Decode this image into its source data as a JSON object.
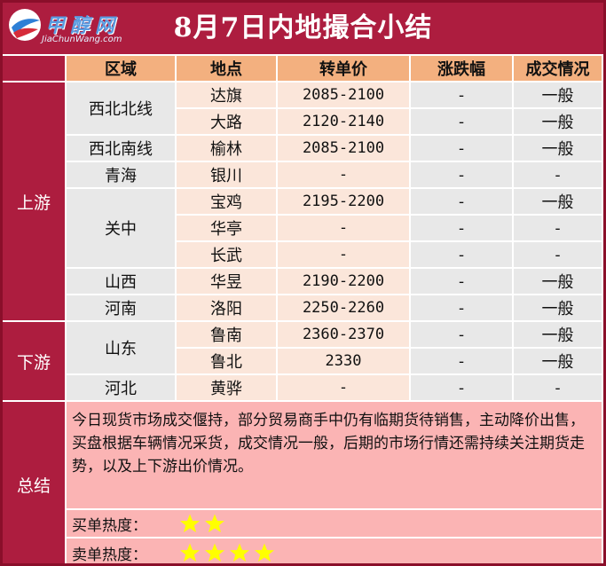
{
  "logo": {
    "cn": "甲醇网",
    "en": "JiaChunWang.com"
  },
  "title": "8月7日内地撮合小结",
  "headers": [
    "区域",
    "地点",
    "转单价",
    "涨跌幅",
    "成交情况"
  ],
  "zones": {
    "upstream": "上游",
    "downstream": "下游",
    "summary": "总结"
  },
  "regions": [
    "西北北线",
    "西北南线",
    "青海",
    "关中",
    "山西",
    "河南",
    "山东",
    "河北"
  ],
  "rows": [
    {
      "place": "达旗",
      "price": "2085-2100",
      "change": "-",
      "volume": "一般"
    },
    {
      "place": "大路",
      "price": "2120-2140",
      "change": "-",
      "volume": "一般"
    },
    {
      "place": "榆林",
      "price": "2085-2100",
      "change": "-",
      "volume": "一般"
    },
    {
      "place": "银川",
      "price": "-",
      "change": "-",
      "volume": "-"
    },
    {
      "place": "宝鸡",
      "price": "2195-2200",
      "change": "-",
      "volume": "一般"
    },
    {
      "place": "华亭",
      "price": "-",
      "change": "-",
      "volume": "-"
    },
    {
      "place": "长武",
      "price": "-",
      "change": "-",
      "volume": "-"
    },
    {
      "place": "华昱",
      "price": "2190-2200",
      "change": "-",
      "volume": "一般"
    },
    {
      "place": "洛阳",
      "price": "2250-2260",
      "change": "-",
      "volume": "一般"
    },
    {
      "place": "鲁南",
      "price": "2360-2370",
      "change": "-",
      "volume": "一般"
    },
    {
      "place": "鲁北",
      "price": "2330",
      "change": "-",
      "volume": "一般"
    },
    {
      "place": "黄骅",
      "price": "-",
      "change": "-",
      "volume": "-"
    }
  ],
  "summary": {
    "text": "今日现货市场成交偃持，部分贸易商手中仍有临期货待销售，主动降价出售，买盘根据车辆情况采货，成交情况一般，后期的市场行情还需持续关注期货走势，以及上下游出价情况。",
    "buy_heat_label": "买单热度：",
    "buy_heat_stars": 2,
    "sell_heat_label": "卖单热度：",
    "sell_heat_stars": 4,
    "star_color": "#ffff00"
  },
  "colors": {
    "brand": "#ad1d3f",
    "header_cell": "#f3b07f",
    "data_cell": "#fbe6da",
    "gray_cell": "#e8e8e8",
    "summary_bg": "#fbb4b4"
  }
}
